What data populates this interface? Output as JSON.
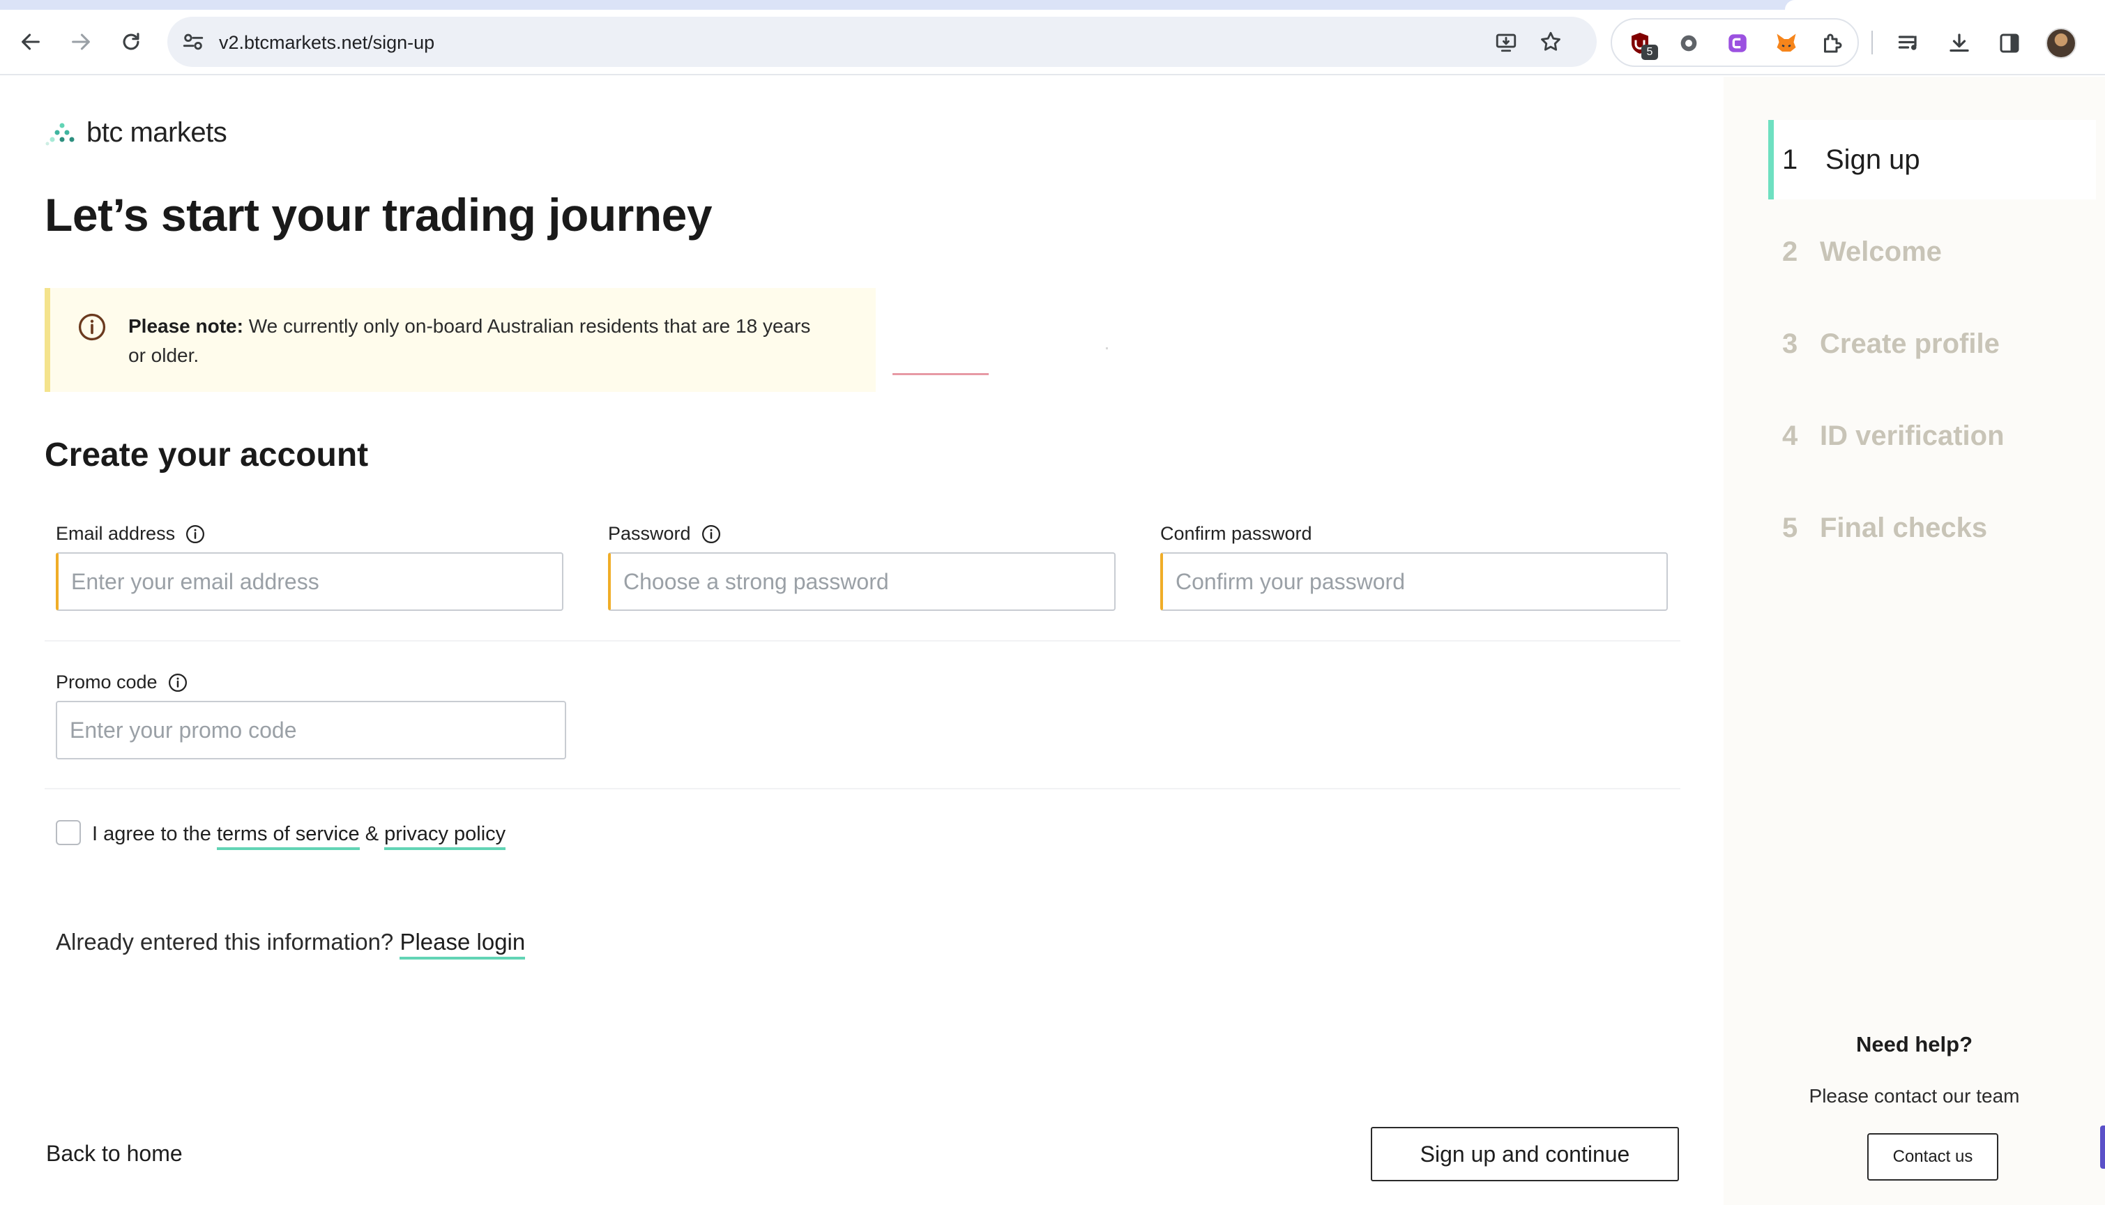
{
  "browser": {
    "url": "v2.btcmarkets.net/sign-up",
    "extension_badge": "5"
  },
  "brand": {
    "logo_text": "btc markets",
    "accent_color": "#62d4b5",
    "warning_color": "#f0ad28"
  },
  "page": {
    "title": "Let’s start your trading journey"
  },
  "notice": {
    "label": "Please note:",
    "text": " We currently only on-board Australian residents that are 18 years or older."
  },
  "form": {
    "section_title": "Create your account",
    "email": {
      "label": "Email address",
      "value": "",
      "placeholder": "Enter your email address"
    },
    "password": {
      "label": "Password",
      "value": "",
      "placeholder": "Choose a strong password"
    },
    "confirm_password": {
      "label": "Confirm password",
      "value": "",
      "placeholder": "Confirm your password"
    },
    "promo": {
      "label": "Promo code",
      "value": "",
      "placeholder": "Enter your promo code"
    },
    "agree": {
      "checked": false,
      "prefix": "I agree to the ",
      "terms_link": "terms of service",
      "ampersand": " & ",
      "privacy_link": "privacy policy"
    },
    "already": {
      "text": "Already entered this information? ",
      "login_link": "Please login"
    }
  },
  "footer": {
    "back_home": "Back to home",
    "submit": "Sign up and continue"
  },
  "sidebar": {
    "steps": [
      {
        "num": "1",
        "label": "Sign up",
        "active": true
      },
      {
        "num": "2",
        "label": "Welcome",
        "active": false
      },
      {
        "num": "3",
        "label": "Create profile",
        "active": false
      },
      {
        "num": "4",
        "label": "ID verification",
        "active": false
      },
      {
        "num": "5",
        "label": "Final checks",
        "active": false
      }
    ],
    "help_title": "Need help?",
    "help_text": "Please contact our team",
    "contact_button": "Contact us"
  }
}
